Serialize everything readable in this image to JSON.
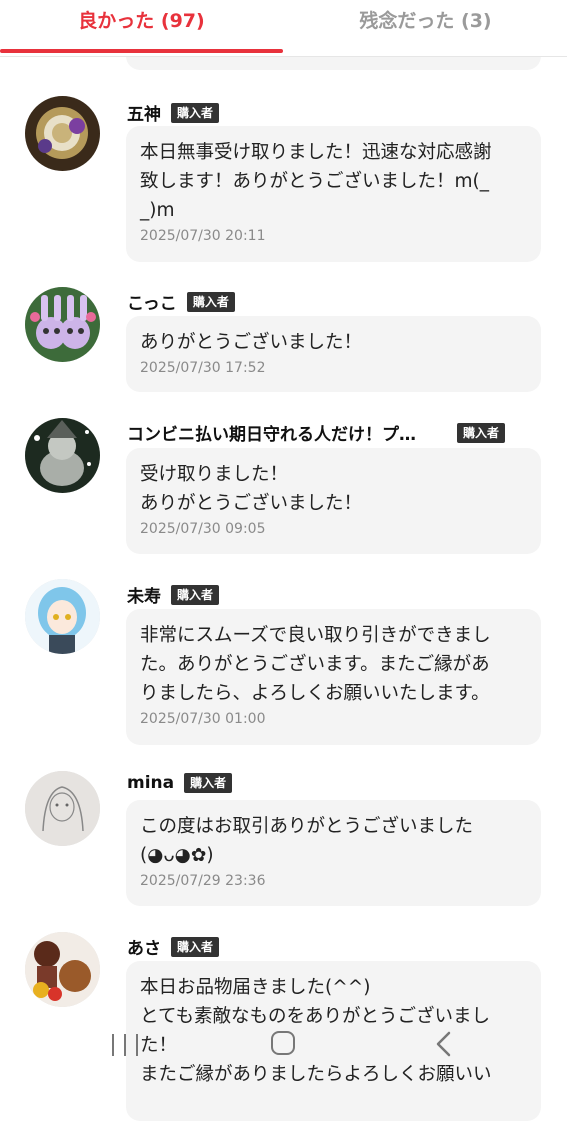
{
  "tabs": {
    "good_label": "良かった (97)",
    "bad_label": "残念だった (3)"
  },
  "badge_label": "購入者",
  "reviews": [
    {
      "name": "五神",
      "comment": "本日無事受け取りました！迅速な対応感謝\n致します！ありがとうございました！m(_\n_)m",
      "date": "2025/07/30 20:11"
    },
    {
      "name": "こっこ",
      "comment": "ありがとうございました！",
      "date": "2025/07/30 17:52"
    },
    {
      "name": "コンビニ払い期日守れる人だけ！プ…",
      "comment": "受け取りました！\nありがとうございました！",
      "date": "2025/07/30 09:05"
    },
    {
      "name": "未寿",
      "comment": "非常にスムーズで良い取り引きができまし\nた。ありがとうございます。またご縁があ\nりましたら、よろしくお願いいたします。",
      "date": "2025/07/30 01:00"
    },
    {
      "name": "mina",
      "comment": "この度はお取引ありがとうございました\n(◕ᴗ◕✿)",
      "date": "2025/07/29 23:36"
    },
    {
      "name": "あさ",
      "comment": "本日お品物届きました(^^)\nとても素敵なものをありがとうございまし\nた！\nまたご縁がありましたらよろしくお願いい",
      "date": ""
    }
  ],
  "icons": {
    "recent": "recent-apps-icon",
    "home": "home-icon",
    "back": "back-icon"
  },
  "colors": {
    "accent": "#e8323c",
    "badge_bg": "#333333",
    "bubble_bg": "#f4f4f4"
  }
}
